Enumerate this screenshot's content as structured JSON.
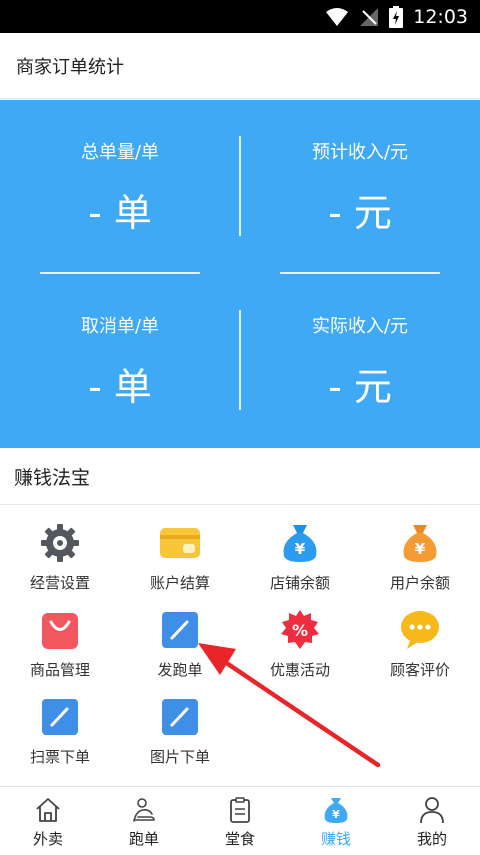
{
  "status_bar": {
    "time": "12:03"
  },
  "header": {
    "title": "商家订单统计"
  },
  "stats": [
    {
      "label": "总单量/单",
      "value": "- 单"
    },
    {
      "label": "预计收入/元",
      "value": "- 元"
    },
    {
      "label": "取消单/单",
      "value": "- 单"
    },
    {
      "label": "实际收入/元",
      "value": "- 元"
    }
  ],
  "section": {
    "title": "赚钱法宝"
  },
  "tools": [
    {
      "label": "经营设置",
      "icon": "gear-icon"
    },
    {
      "label": "账户结算",
      "icon": "card-icon"
    },
    {
      "label": "店铺余额",
      "icon": "money-bag-icon"
    },
    {
      "label": "用户余额",
      "icon": "money-bag-icon"
    },
    {
      "label": "商品管理",
      "icon": "shopping-bag-icon"
    },
    {
      "label": "发跑单",
      "icon": "pencil-icon"
    },
    {
      "label": "优惠活动",
      "icon": "discount-icon"
    },
    {
      "label": "顾客评价",
      "icon": "chat-bubble-icon"
    },
    {
      "label": "扫票下单",
      "icon": "pencil-icon"
    },
    {
      "label": "图片下单",
      "icon": "pencil-icon"
    }
  ],
  "tabs": [
    {
      "label": "外卖",
      "icon": "house-icon"
    },
    {
      "label": "跑单",
      "icon": "runner-icon"
    },
    {
      "label": "堂食",
      "icon": "clipboard-icon"
    },
    {
      "label": "赚钱",
      "icon": "money-bag-icon",
      "active": true
    },
    {
      "label": "我的",
      "icon": "person-icon"
    }
  ],
  "colors": {
    "accent": "#3fa9f5",
    "arrow": "#e8262a"
  }
}
